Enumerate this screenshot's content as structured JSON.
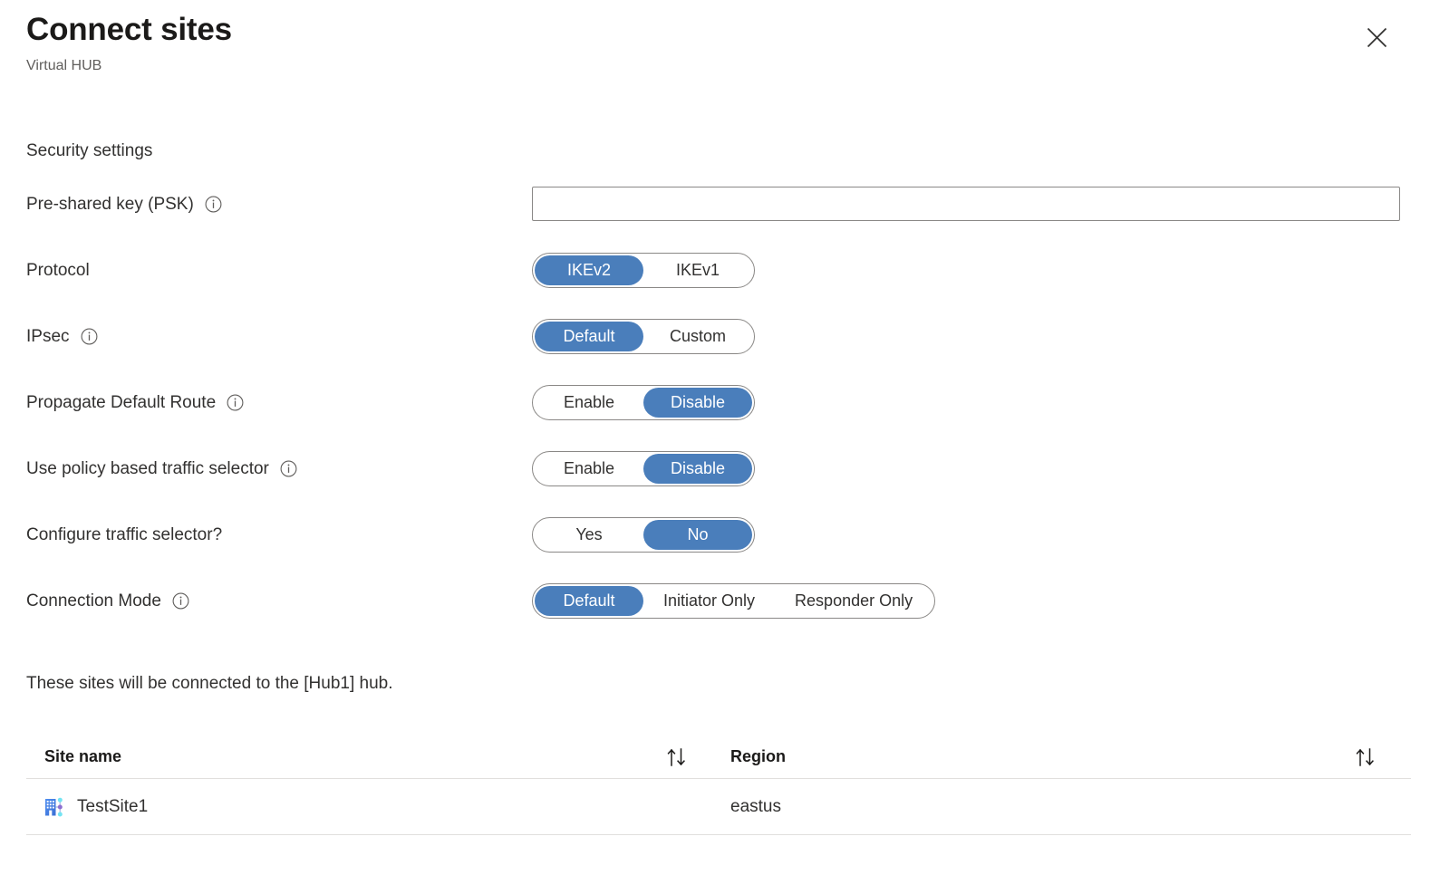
{
  "header": {
    "title": "Connect sites",
    "subtitle": "Virtual HUB",
    "close_label": "Close",
    "close_icon": "close-icon"
  },
  "form": {
    "section_title": "Security settings",
    "rows": [
      {
        "label": "Pre-shared key (PSK)",
        "info": true,
        "type": "text",
        "value": "",
        "placeholder": ""
      },
      {
        "label": "Protocol",
        "info": false,
        "type": "segmented",
        "options": [
          "IKEv2",
          "IKEv1"
        ],
        "selected": "IKEv2"
      },
      {
        "label": "IPsec",
        "info": true,
        "type": "segmented",
        "options": [
          "Default",
          "Custom"
        ],
        "selected": "Default"
      },
      {
        "label": "Propagate Default Route",
        "info": true,
        "type": "segmented",
        "options": [
          "Enable",
          "Disable"
        ],
        "selected": "Disable"
      },
      {
        "label": "Use policy based traffic selector",
        "info": true,
        "type": "segmented",
        "options": [
          "Enable",
          "Disable"
        ],
        "selected": "Disable"
      },
      {
        "label": "Configure traffic selector?",
        "info": false,
        "type": "segmented",
        "options": [
          "Yes",
          "No"
        ],
        "selected": "No"
      },
      {
        "label": "Connection Mode",
        "info": true,
        "type": "segmented",
        "options": [
          "Default",
          "Initiator Only",
          "Responder Only"
        ],
        "selected": "Default"
      }
    ]
  },
  "sites": {
    "note": "These sites will be connected to the [Hub1] hub.",
    "columns": [
      {
        "label": "Site name",
        "sort_icon": "sort-ascending-descending-icon"
      },
      {
        "label": "Region",
        "sort_icon": "sort-ascending-descending-icon"
      }
    ],
    "rows": [
      {
        "site_name": "TestSite1",
        "region": "eastus",
        "icon": "branch-site-icon"
      }
    ]
  },
  "colors": {
    "accent": "#4a7ebb",
    "text": "#323130",
    "subtitle": "#605e5c",
    "border": "#8a8886",
    "divider": "#e1dfdd"
  }
}
